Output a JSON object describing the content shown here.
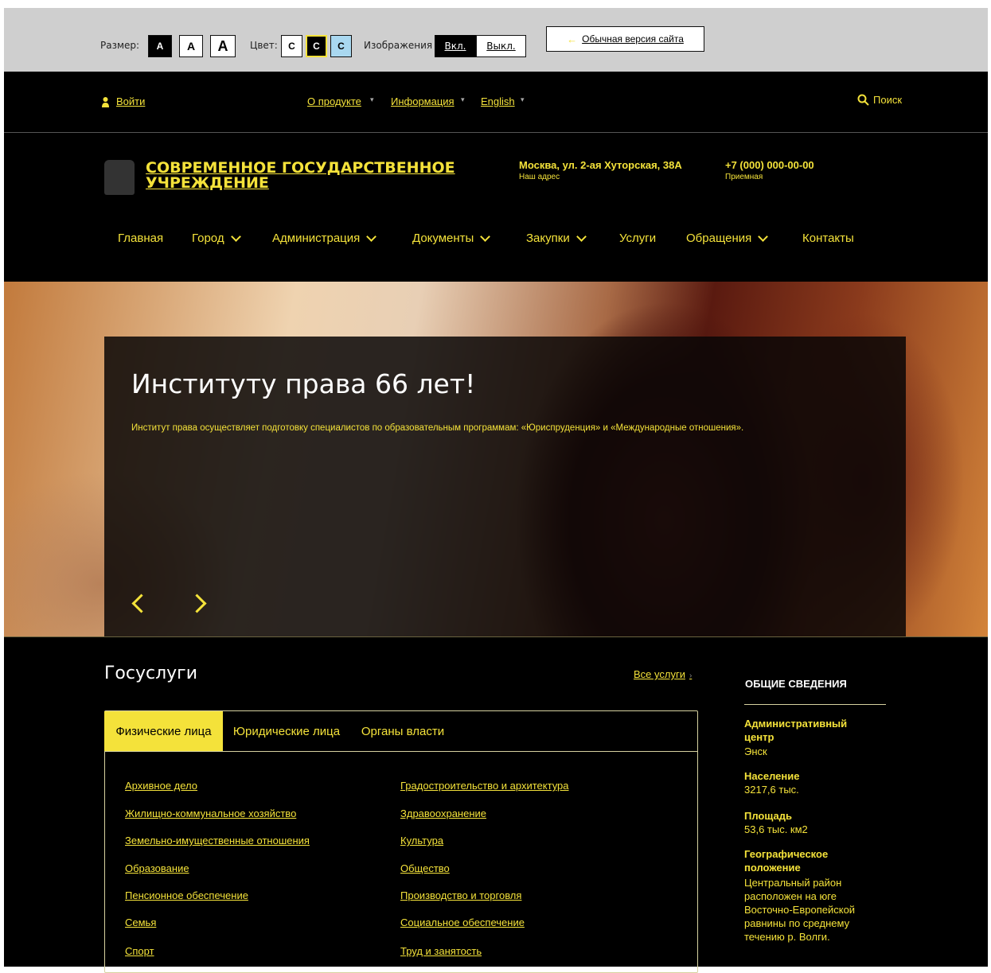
{
  "a11y": {
    "size_label": "Размер:",
    "size_buttons": [
      "A",
      "A",
      "A"
    ],
    "color_label": "Цвет:",
    "color_buttons": [
      "C",
      "C",
      "C"
    ],
    "images_label": "Изображения",
    "images_on": "Вкл.",
    "images_off": "Выкл.",
    "normal_version": "Обычная версия сайта"
  },
  "topbar": {
    "login": "Войти",
    "links": [
      "О продукте",
      "Информация",
      "English"
    ],
    "search": "Поиск"
  },
  "header": {
    "org_line1": "СОВРЕМЕННОЕ ГОСУДАРСТВЕННОЕ",
    "org_line2": "УЧРЕЖДЕНИЕ",
    "address": "Москва, ул. 2-ая Хуторская, 38А",
    "address_caption": "Наш адрес",
    "phone": "+7 (000) 000-00-00",
    "phone_caption": "Приемная"
  },
  "nav": [
    "Главная",
    "Город",
    "Администрация",
    "Документы",
    "Закупки",
    "Услуги",
    "Обращения",
    "Контакты"
  ],
  "hero": {
    "title": "Институту права 66 лет!",
    "text": "Институт права осуществляет подготовку специалистов по образовательным программам: «Юриспруденция» и «Международные отношения»."
  },
  "services": {
    "title": "Госуслуги",
    "all_link": "Все услуги",
    "tabs": [
      "Физические лица",
      "Юридические лица",
      "Органы власти"
    ],
    "left": [
      "Архивное дело",
      "Жилищно-коммунальное хозяйство",
      "Земельно-имущественные отношения",
      "Образование",
      "Пенсионное обеспечение",
      "Семья",
      "Спорт"
    ],
    "right": [
      "Градостроительство и архитектура",
      "Здравоохранение",
      "Культура",
      "Общество",
      "Производство и торговля",
      "Социальное обеспечение",
      "Труд и занятость"
    ]
  },
  "info": {
    "heading": "ОБЩИЕ СВЕДЕНИЯ",
    "admin_title": "Административный центр",
    "admin_value": "Энск",
    "population_title": "Население",
    "population_value": "3217,6 тыс.",
    "area_title": "Площадь",
    "area_value": "53,6 тыс. км2",
    "geo_title": "Географическое положение",
    "geo_value": "Центральный район расположен на юге Восточно-Европейской равнины по среднему течению р. Волги."
  },
  "colors": {
    "accent": "#f4e23a",
    "background": "#000000",
    "toolbar": "#cfcfcf",
    "scheme_blue": "#a9d8f0"
  }
}
